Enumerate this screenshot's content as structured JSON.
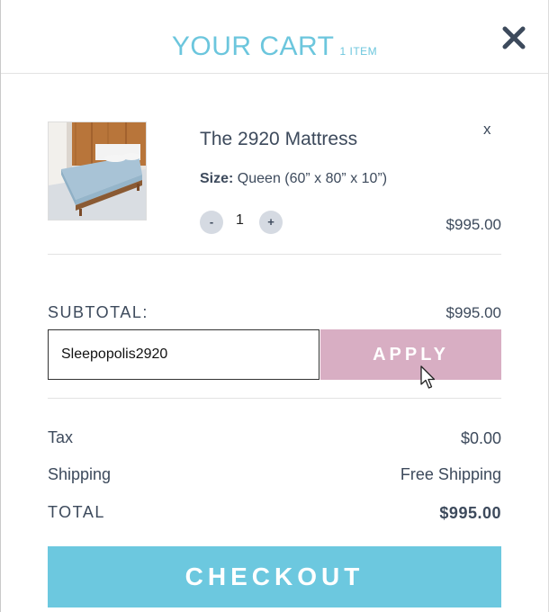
{
  "header": {
    "title": "YOUR CART",
    "item_count": "1 ITEM"
  },
  "product": {
    "name": "The 2920 Mattress",
    "size_label": "Size:",
    "size_value": "Queen (60” x 80” x 10”)",
    "quantity": "1",
    "minus_label": "-",
    "plus_label": "+",
    "remove_label": "x",
    "price": "$995.00",
    "image_icon": "mattress-product-photo"
  },
  "subtotal": {
    "label": "SUBTOTAL:",
    "value": "$995.00"
  },
  "promo": {
    "value": "Sleepopolis2920",
    "apply_label": "APPLY"
  },
  "totals": {
    "tax_label": "Tax",
    "tax_value": "$0.00",
    "shipping_label": "Shipping",
    "shipping_value": "Free Shipping",
    "total_label": "TOTAL",
    "total_value": "$995.00"
  },
  "checkout": {
    "label": "CHECKOUT"
  },
  "colors": {
    "accent": "#6cc6dd",
    "apply_button": "#d8aec3",
    "text": "#3d4a5c",
    "qty_button": "#d5dae2"
  }
}
